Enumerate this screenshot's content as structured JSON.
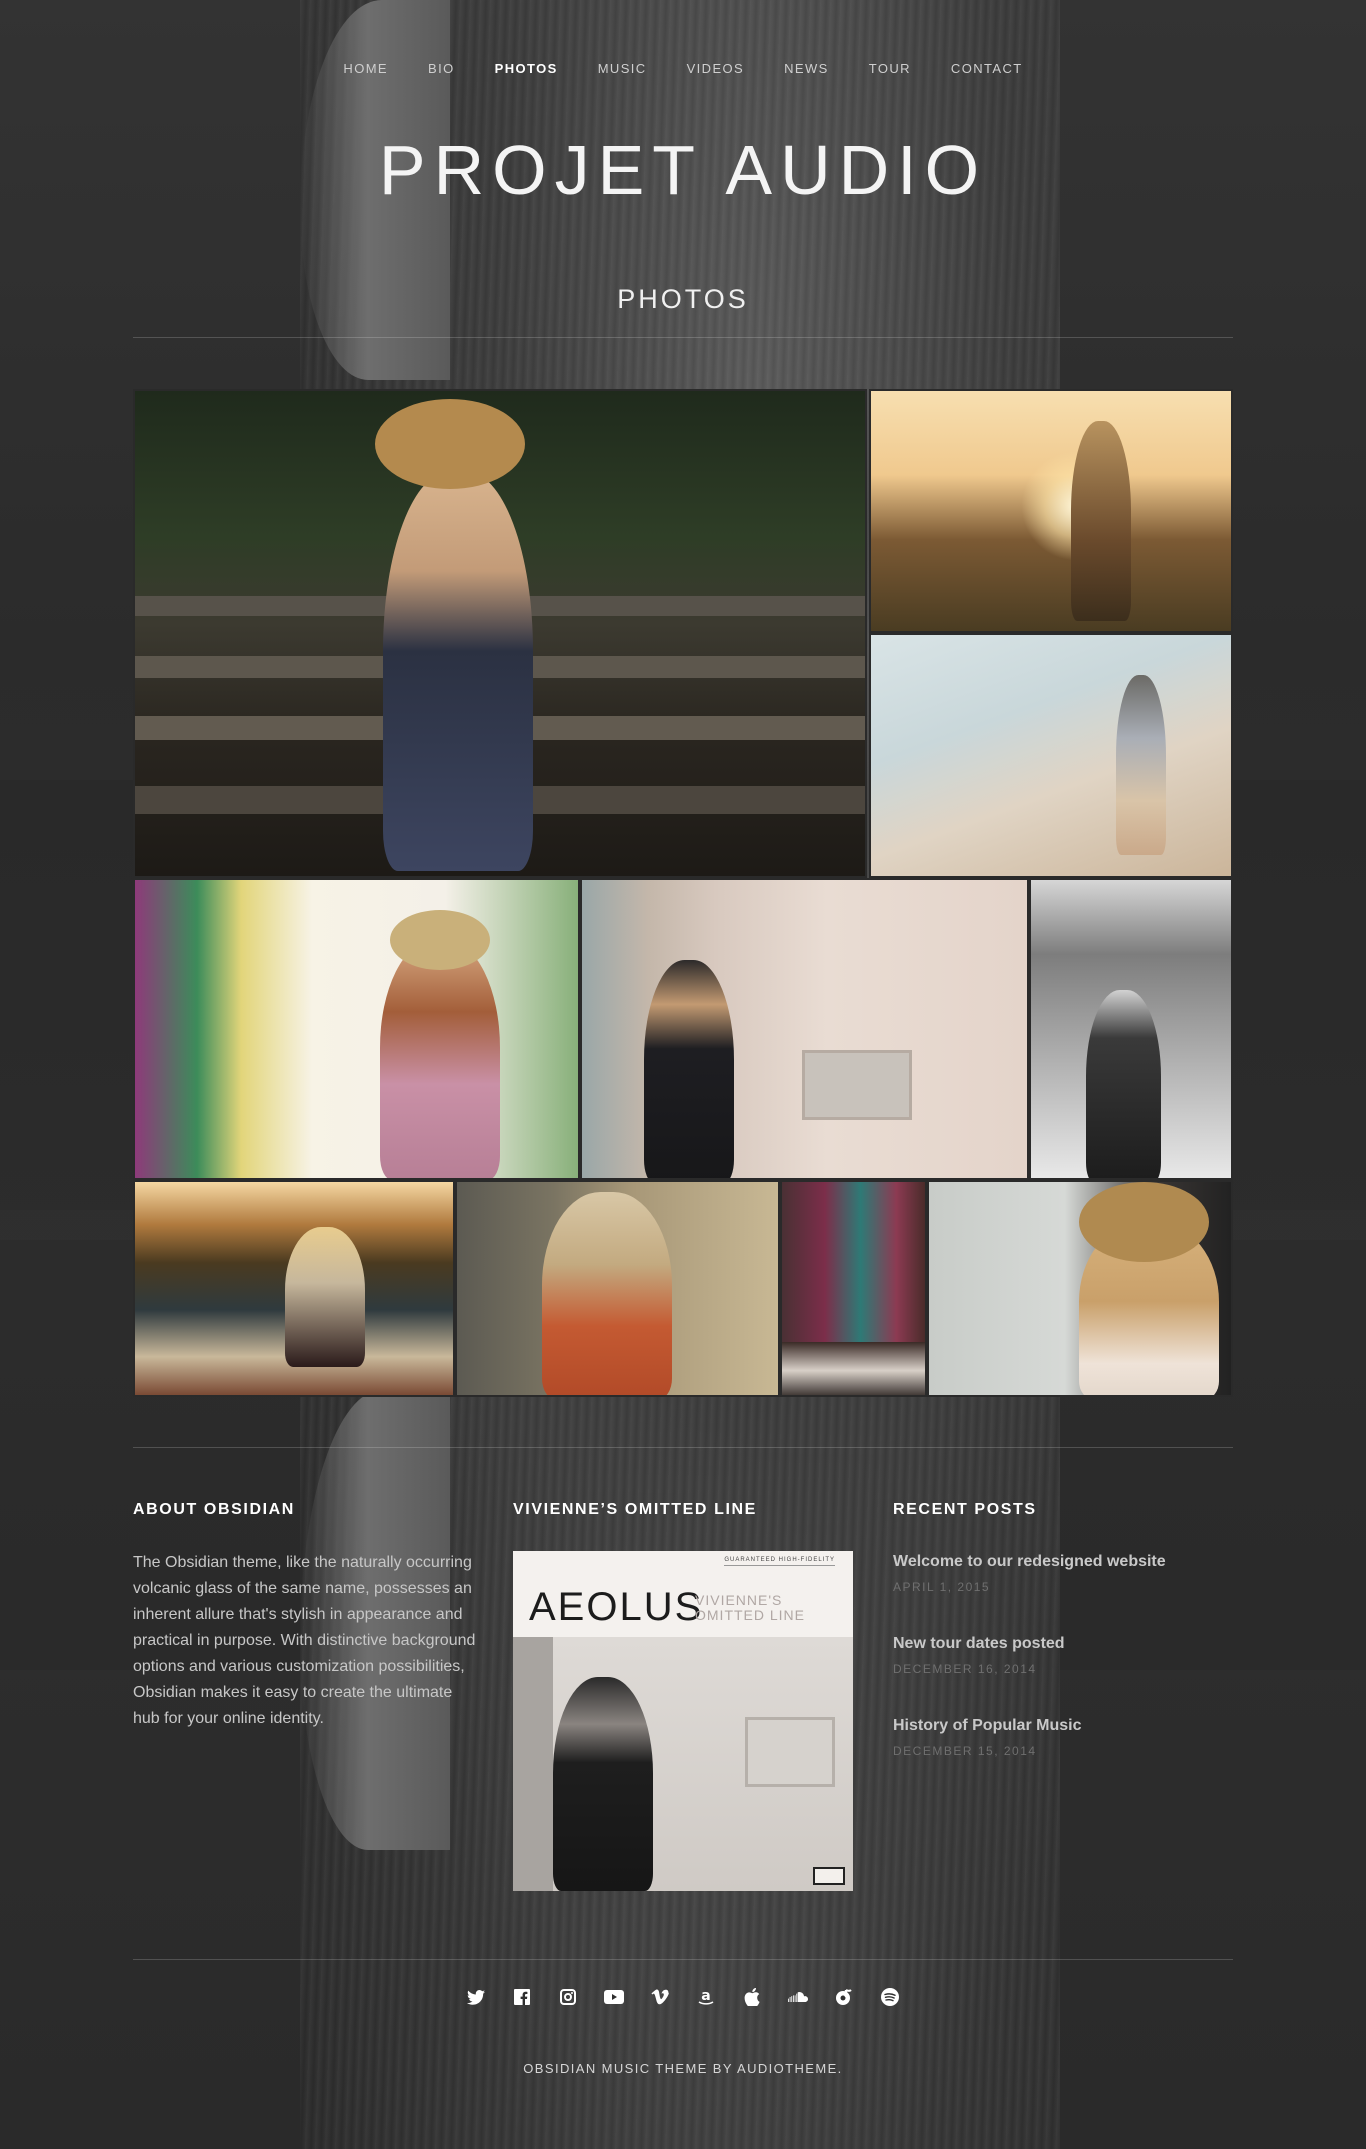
{
  "nav": {
    "items": [
      {
        "label": "HOME",
        "active": false
      },
      {
        "label": "BIO",
        "active": false
      },
      {
        "label": "PHOTOS",
        "active": true
      },
      {
        "label": "MUSIC",
        "active": false
      },
      {
        "label": "VIDEOS",
        "active": false
      },
      {
        "label": "NEWS",
        "active": false
      },
      {
        "label": "TOUR",
        "active": false
      },
      {
        "label": "CONTACT",
        "active": false
      }
    ]
  },
  "site": {
    "title": "PROJET AUDIO"
  },
  "page": {
    "title": "PHOTOS"
  },
  "widgets": {
    "about": {
      "title": "ABOUT OBSIDIAN",
      "text": "The Obsidian theme, like the naturally occurring volcanic glass of the same name, possesses an inherent allure that's stylish in appearance and practical in purpose. With distinctive background options and various customization possibilities, Obsidian makes it easy to create the ultimate hub for your online identity."
    },
    "record": {
      "title": "VIVIENNE’S OMITTED LINE",
      "cover_tagline": "GUARANTEED HIGH-FIDELITY",
      "cover_title": "AEOLUS",
      "cover_subtitle": "VIVIENNE'S OMITTED LINE"
    },
    "recent": {
      "title": "RECENT POSTS",
      "posts": [
        {
          "title": "Welcome to our redesigned website",
          "date": "APRIL 1, 2015"
        },
        {
          "title": "New tour dates posted",
          "date": "DECEMBER 16, 2014"
        },
        {
          "title": "History of Popular Music",
          "date": "DECEMBER 15, 2014"
        }
      ]
    }
  },
  "social_icons": [
    "twitter-icon",
    "facebook-icon",
    "instagram-icon",
    "youtube-icon",
    "vimeo-icon",
    "amazon-icon",
    "apple-icon",
    "soundcloud-icon",
    "rdio-icon",
    "spotify-icon"
  ],
  "footer": {
    "credit": "OBSIDIAN MUSIC THEME BY AUDIOTHEME."
  }
}
